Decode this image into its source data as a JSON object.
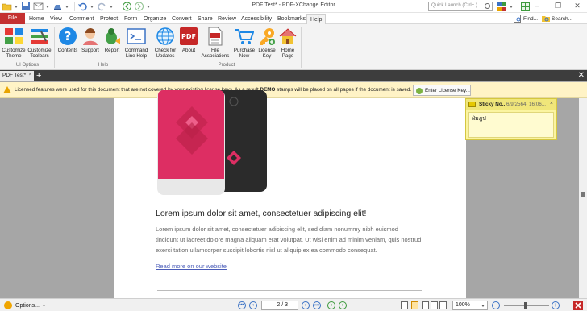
{
  "window": {
    "title": "PDF Test* - PDF-XChange Editor",
    "quick_launch_placeholder": "Quick Launch (Ctrl+.)",
    "minimize": "–",
    "restore": "❐",
    "close": "✕"
  },
  "ribbon_tabs": [
    {
      "label": "File"
    },
    {
      "label": "Home"
    },
    {
      "label": "View"
    },
    {
      "label": "Comment"
    },
    {
      "label": "Protect"
    },
    {
      "label": "Form"
    },
    {
      "label": "Organize"
    },
    {
      "label": "Convert"
    },
    {
      "label": "Share"
    },
    {
      "label": "Review"
    },
    {
      "label": "Accessibility"
    },
    {
      "label": "Bookmarks"
    },
    {
      "label": "Help"
    }
  ],
  "ribbon_right": {
    "find": "Find...",
    "search": "Search..."
  },
  "ribbon": {
    "buttons": [
      {
        "label1": "Customize",
        "label2": "Theme",
        "icon": "customize-theme-icon"
      },
      {
        "label1": "Customize",
        "label2": "Toolbars",
        "icon": "customize-toolbars-icon"
      },
      {
        "label1": "Contents",
        "label2": "",
        "icon": "help-contents-icon"
      },
      {
        "label1": "Support",
        "label2": "",
        "icon": "support-icon"
      },
      {
        "label1": "Report",
        "label2": "",
        "icon": "report-bug-icon"
      },
      {
        "label1": "Command",
        "label2": "Line Help",
        "icon": "command-line-icon"
      },
      {
        "label1": "Check for",
        "label2": "Updates",
        "icon": "globe-icon"
      },
      {
        "label1": "About",
        "label2": "",
        "icon": "pdf-about-icon"
      },
      {
        "label1": "File",
        "label2": "Associations",
        "icon": "file-associations-icon"
      },
      {
        "label1": "Purchase",
        "label2": "Now",
        "icon": "cart-icon"
      },
      {
        "label1": "License",
        "label2": "Key",
        "icon": "license-key-icon"
      },
      {
        "label1": "Home",
        "label2": "Page",
        "icon": "home-icon"
      }
    ],
    "groups": {
      "ui_options": "UI Options",
      "help": "Help",
      "product": "Product"
    }
  },
  "doc_tab": {
    "label": "PDF Test*",
    "close": "×",
    "new_tab": "+",
    "close_all": "✕"
  },
  "warning": {
    "text_before": "Licensed features were used for this document that are not covered by your existing license keys. As a result ",
    "text_bold": "DEMO",
    "text_after": " stamps will be placed on all pages if the document is saved.",
    "button": "Enter License Key..."
  },
  "document": {
    "headline": "Lorem ipsum dolor sit amet, consectetuer adipiscing elit!",
    "body": "Lorem ipsum dolor sit amet, consectetuer adipiscing elit, sed diam nonummy nibh euismod tincidunt ut laoreet dolore magna aliquam erat volutpat. Ut wisi enim ad minim veniam, quis nostrud exerci tation ullamcorper suscipit lobortis nisl ut aliquip ex ea commodo consequat.",
    "link": "Read more on our website"
  },
  "sticky_note": {
    "author": "Sticky No..",
    "date": "6/9/2564, 16:06...",
    "close": "×",
    "content": "ฝ่มฎป"
  },
  "statusbar": {
    "options": "Options...",
    "page_value": "2 / 3",
    "zoom_value": "100%",
    "zoom_minus": "−",
    "zoom_plus": "+"
  },
  "colors": {
    "file_tab": "#c43131",
    "warning_bg": "#fff3c6",
    "pink_phone": "#dd2e63",
    "link": "#4a5cb8",
    "sticky_bg": "#fbf4a0"
  }
}
